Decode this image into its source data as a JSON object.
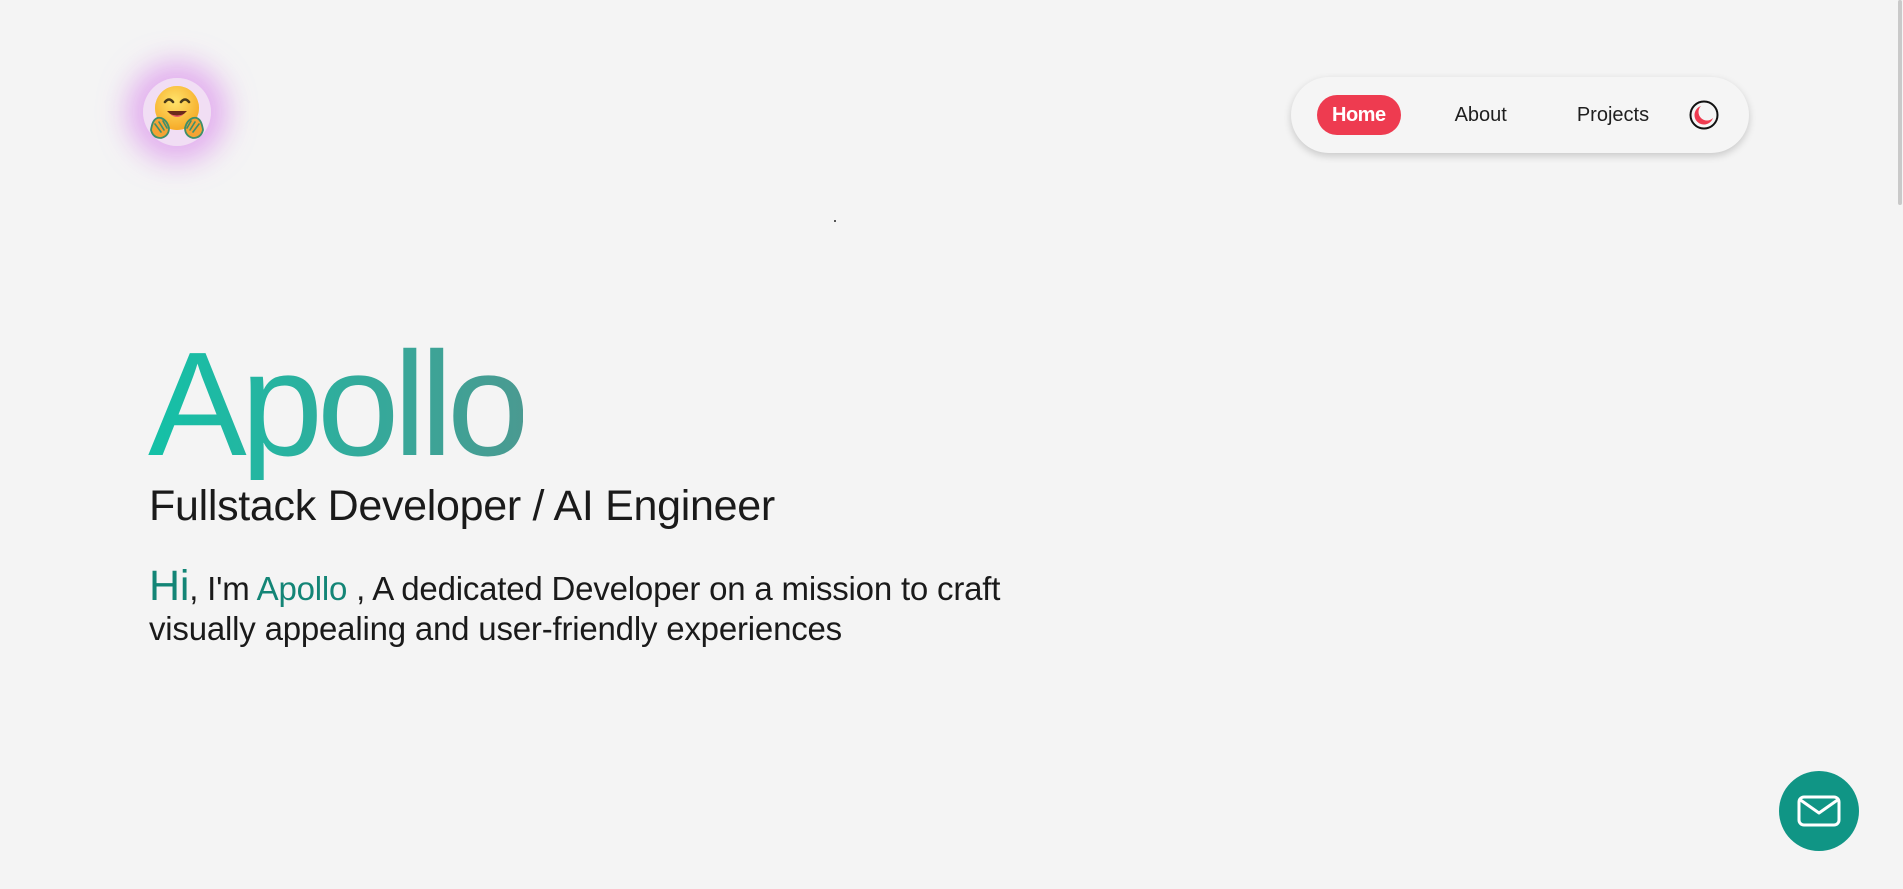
{
  "header": {
    "logo_icon": "hugging-face-emoji-icon",
    "nav": {
      "items": [
        {
          "label": "Home",
          "active": true
        },
        {
          "label": "About",
          "active": false
        },
        {
          "label": "Projects",
          "active": false
        }
      ],
      "theme_toggle_icon": "moon-icon"
    }
  },
  "hero": {
    "name": "Apollo",
    "role": "Fullstack Developer / AI Engineer",
    "intro": {
      "greeting": "Hi",
      "im": ", I'm ",
      "name": "Apollo",
      "rest": " , A dedicated Developer on a mission to craft visually appealing and user-friendly experiences"
    }
  },
  "contact": {
    "icon": "mail-icon"
  },
  "colors": {
    "accent_red": "#ee3b50",
    "accent_teal": "#109585",
    "name_gradient_start": "#14c1a7",
    "name_gradient_end": "#4a9a91",
    "logo_glow": "#d678eb",
    "background": "#f4f4f4"
  }
}
